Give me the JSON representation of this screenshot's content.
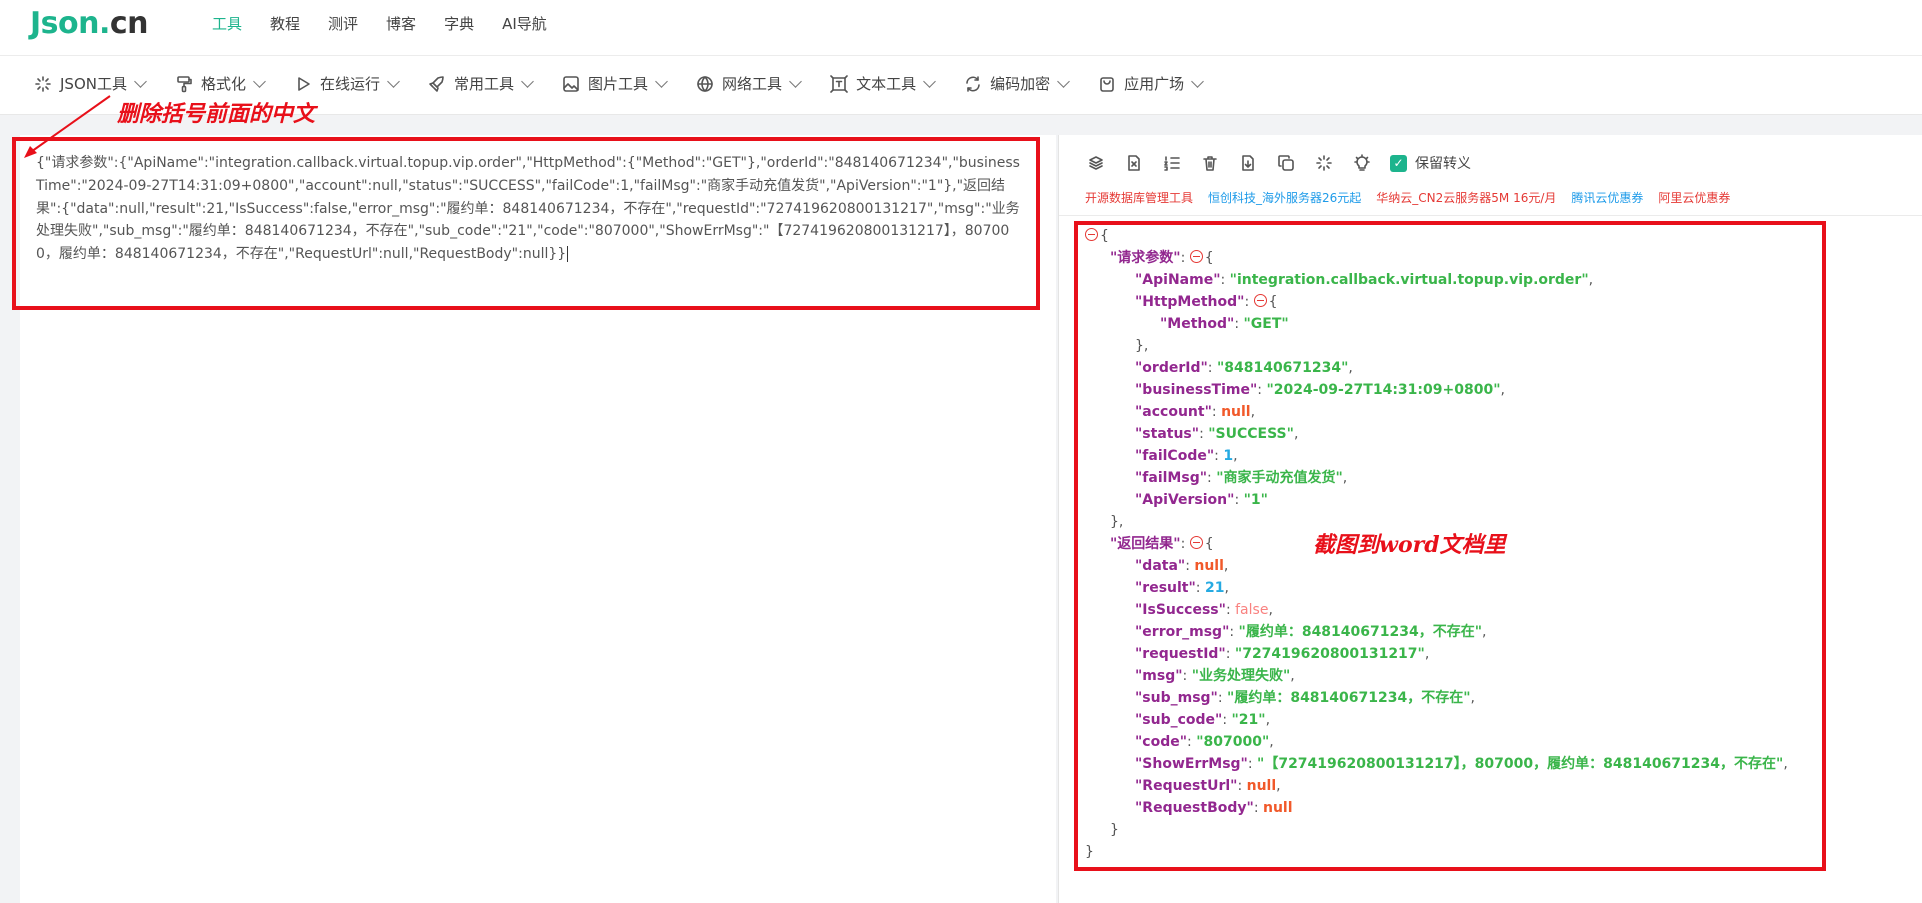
{
  "brand": {
    "part1": "Json.",
    "part2": "cn"
  },
  "topnav": [
    "工具",
    "教程",
    "测评",
    "博客",
    "字典",
    "AI导航"
  ],
  "tools": [
    {
      "label": "JSON工具",
      "icon": "sparkle-icon"
    },
    {
      "label": "格式化",
      "icon": "paint-roller-icon"
    },
    {
      "label": "在线运行",
      "icon": "play-icon"
    },
    {
      "label": "常用工具",
      "icon": "rocket-icon"
    },
    {
      "label": "图片工具",
      "icon": "image-icon"
    },
    {
      "label": "网络工具",
      "icon": "globe-icon"
    },
    {
      "label": "文本工具",
      "icon": "text-frame-icon"
    },
    {
      "label": "编码加密",
      "icon": "refresh-icon"
    },
    {
      "label": "应用广场",
      "icon": "bag-icon"
    }
  ],
  "input_text": "{\"请求参数\":{\"ApiName\":\"integration.callback.virtual.topup.vip.order\",\"HttpMethod\":{\"Method\":\"GET\"},\"orderId\":\"848140671234\",\"businessTime\":\"2024-09-27T14:31:09+0800\",\"account\":null,\"status\":\"SUCCESS\",\"failCode\":1,\"failMsg\":\"商家手动充值发货\",\"ApiVersion\":\"1\"},\"返回结果\":{\"data\":null,\"result\":21,\"IsSuccess\":false,\"error_msg\":\"履约单：848140671234，不存在\",\"requestId\":\"727419620800131217\",\"msg\":\"业务处理失败\",\"sub_msg\":\"履约单：848140671234，不存在\",\"sub_code\":\"21\",\"code\":\"807000\",\"ShowErrMsg\":\"【727419620800131217】，807000，履约单：848140671234，不存在\",\"RequestUrl\":null,\"RequestBody\":null}}",
  "right_toolbar": {
    "icons": [
      "layers-icon",
      "file-x-icon",
      "list-ordered-icon",
      "trash-icon",
      "file-download-icon",
      "copy-icon",
      "sparkle-icon",
      "bulb-icon"
    ],
    "keep_escape_label": "保留转义",
    "keep_escape_checked": true
  },
  "ads": [
    {
      "label": "开源数据库管理工具",
      "color": "#e53935"
    },
    {
      "label": "恒创科技_海外服务器26元起",
      "color": "#1e9be9"
    },
    {
      "label": "华纳云_CN2云服务器5M 16元/月",
      "color": "#e53935"
    },
    {
      "label": "腾讯云优惠券",
      "color": "#1e9be9"
    },
    {
      "label": "阿里云优惠券",
      "color": "#e53935"
    }
  ],
  "json_root": {
    "请求参数": {
      "ApiName": "integration.callback.virtual.topup.vip.order",
      "HttpMethod": {
        "Method": "GET"
      },
      "orderId": "848140671234",
      "businessTime": "2024-09-27T14:31:09+0800",
      "account": null,
      "status": "SUCCESS",
      "failCode": 1,
      "failMsg": "商家手动充值发货",
      "ApiVersion": "1"
    },
    "返回结果": {
      "data": null,
      "result": 21,
      "IsSuccess": false,
      "error_msg": "履约单：848140671234，不存在",
      "requestId": "727419620800131217",
      "msg": "业务处理失败",
      "sub_msg": "履约单：848140671234，不存在",
      "sub_code": "21",
      "code": "807000",
      "ShowErrMsg": "【727419620800131217】，807000，履约单：848140671234，不存在",
      "RequestUrl": null,
      "RequestBody": null
    }
  },
  "annotations": {
    "left": "删除括号前面的中文",
    "right": "截图到word文档里",
    "color": "#e8101a"
  },
  "colors": {
    "accent": "#1db48d",
    "key": "#92278f",
    "string": "#3ab54a",
    "number": "#25aae2",
    "null": "#f1592a",
    "boolean": "#f98280"
  }
}
